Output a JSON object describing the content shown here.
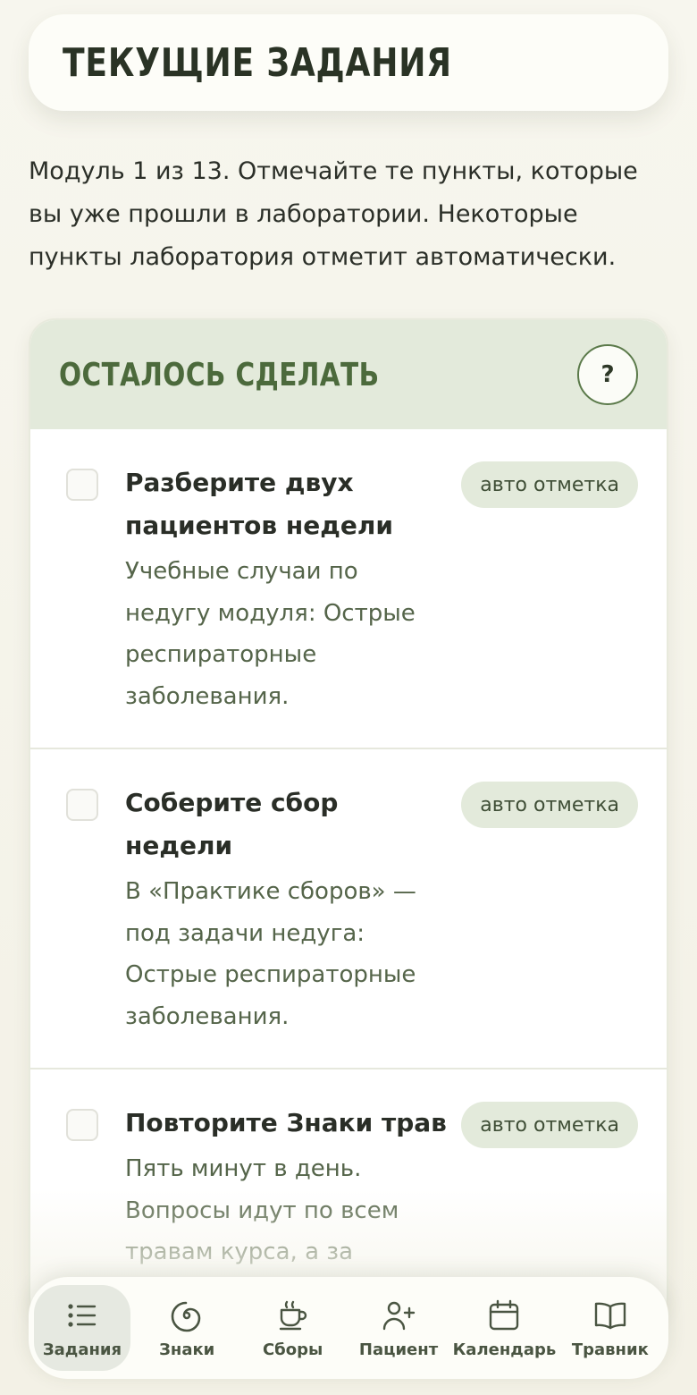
{
  "header": {
    "title": "ТЕКУЩИЕ ЗАДАНИЯ"
  },
  "intro": {
    "text": "Модуль 1 из 13. Отмечайте те пункты, которые вы уже прошли в лаборатории. Некоторые пункты лаборатория отметит автоматически."
  },
  "panel": {
    "title": "ОСТАЛОСЬ СДЕЛАТЬ",
    "help_label": "?",
    "tasks": [
      {
        "title": "Разберите двух пациентов недели",
        "description": "Учебные случаи по недугу модуля: Острые респираторные заболевания.",
        "badge": "авто отметка",
        "checked": false
      },
      {
        "title": "Соберите сбор недели",
        "description": "В «Практике сборов» — под задачи недуга: Острые респираторные заболевания.",
        "badge": "авто отметка",
        "checked": false
      },
      {
        "title": "Повторите Знаки трав",
        "description": "Пять минут в день. Вопросы идут по всем травам курса, а за модуль нужно набрать",
        "badge": "авто отметка",
        "checked": false
      }
    ]
  },
  "nav": {
    "items": [
      {
        "label": "Задания",
        "icon": "list-icon",
        "active": true
      },
      {
        "label": "Знаки",
        "icon": "spiral-icon",
        "active": false
      },
      {
        "label": "Сборы",
        "icon": "cup-icon",
        "active": false
      },
      {
        "label": "Пациент",
        "icon": "user-plus-icon",
        "active": false
      },
      {
        "label": "Календарь",
        "icon": "calendar-icon",
        "active": false
      },
      {
        "label": "Травник",
        "icon": "book-icon",
        "active": false
      }
    ]
  },
  "colors": {
    "accent": "#4c6a3c",
    "panel_head": "#e3eadb",
    "badge_bg": "#e3eadb",
    "background": "#f5f4ea"
  }
}
